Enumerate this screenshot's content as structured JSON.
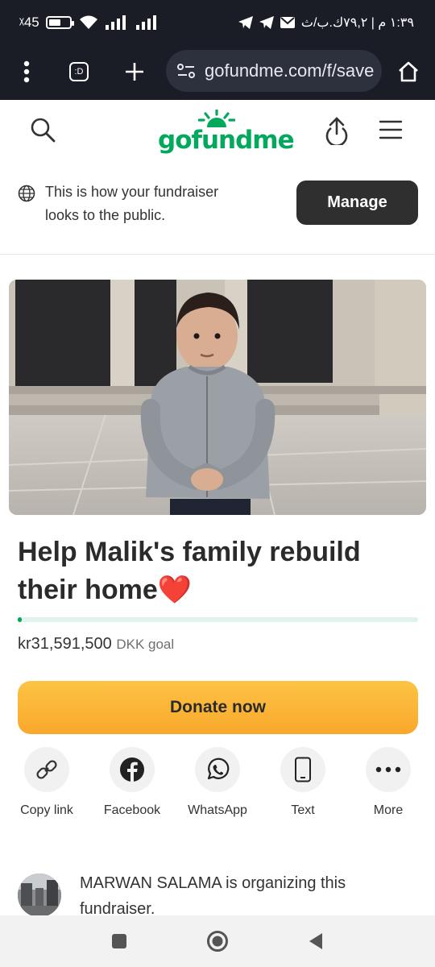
{
  "status_bar": {
    "network": "ᵡ45",
    "battery_level": 0.6,
    "right_text": "١:٣٩ م | ٧٩,٢ك.ب/ث"
  },
  "browser": {
    "tab_label": ":D",
    "url": "gofundme.com/f/save"
  },
  "site": {
    "logo": "gofundme",
    "brand_color": "#02a95c"
  },
  "owner_banner": {
    "message": "This is how your fundraiser looks to the public.",
    "manage_label": "Manage"
  },
  "fundraiser": {
    "title": "Help Malik's family rebuild their home❤️",
    "progress_fraction": 0.01,
    "goal_amount": "kr31,591,500",
    "goal_unit": "DKK goal",
    "donate_label": "Donate now"
  },
  "share": [
    {
      "label": "Copy link",
      "icon": "link-icon"
    },
    {
      "label": "Facebook",
      "icon": "facebook-icon"
    },
    {
      "label": "WhatsApp",
      "icon": "whatsapp-icon"
    },
    {
      "label": "Text",
      "icon": "phone-icon"
    },
    {
      "label": "More",
      "icon": "more-icon"
    }
  ],
  "organizer": {
    "text": "MARWAN SALAMA is organizing this fundraiser."
  }
}
